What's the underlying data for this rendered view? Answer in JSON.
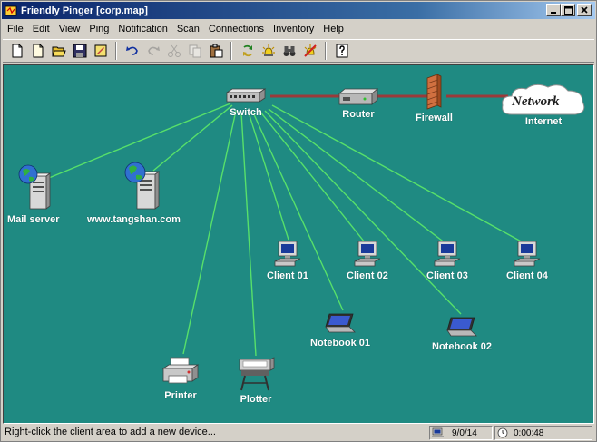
{
  "window": {
    "title": "Friendly Pinger [corp.map]"
  },
  "menu": [
    "File",
    "Edit",
    "View",
    "Ping",
    "Notification",
    "Scan",
    "Connections",
    "Inventory",
    "Help"
  ],
  "devices": {
    "switch": "Switch",
    "router": "Router",
    "firewall": "Firewall",
    "internet_cloud": "Network",
    "internet": "Internet",
    "mail_server": "Mail server",
    "web_server": "www.tangshan.com",
    "client_01": "Client 01",
    "client_02": "Client 02",
    "client_03": "Client 03",
    "client_04": "Client 04",
    "notebook_01": "Notebook 01",
    "notebook_02": "Notebook 02",
    "printer": "Printer",
    "plotter": "Plotter"
  },
  "status": {
    "hint": "Right-click the client area to add a new device...",
    "count": "9/0/14",
    "time": "0:00:48"
  },
  "colors": {
    "map_background": "#1f8a82",
    "link": "#57e06a",
    "wan_link": "#9a3a3a"
  }
}
